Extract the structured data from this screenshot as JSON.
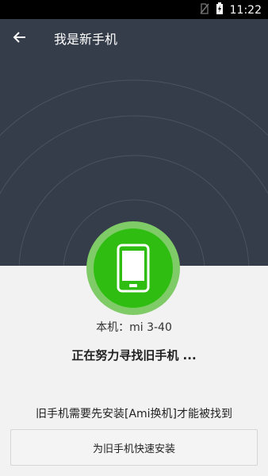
{
  "status": {
    "time": "11:22"
  },
  "appbar": {
    "title": "我是新手机",
    "back_icon": "arrow-back-icon"
  },
  "device": {
    "label": "本机：mi 3-40"
  },
  "search": {
    "text": "正在努力寻找旧手机 ..."
  },
  "note": {
    "text": "旧手机需要先安装[Ami换机]才能被找到"
  },
  "install": {
    "label": "为旧手机快速安装"
  },
  "colors": {
    "header_bg": "#353d4a",
    "accent_green": "#2fbd12"
  }
}
